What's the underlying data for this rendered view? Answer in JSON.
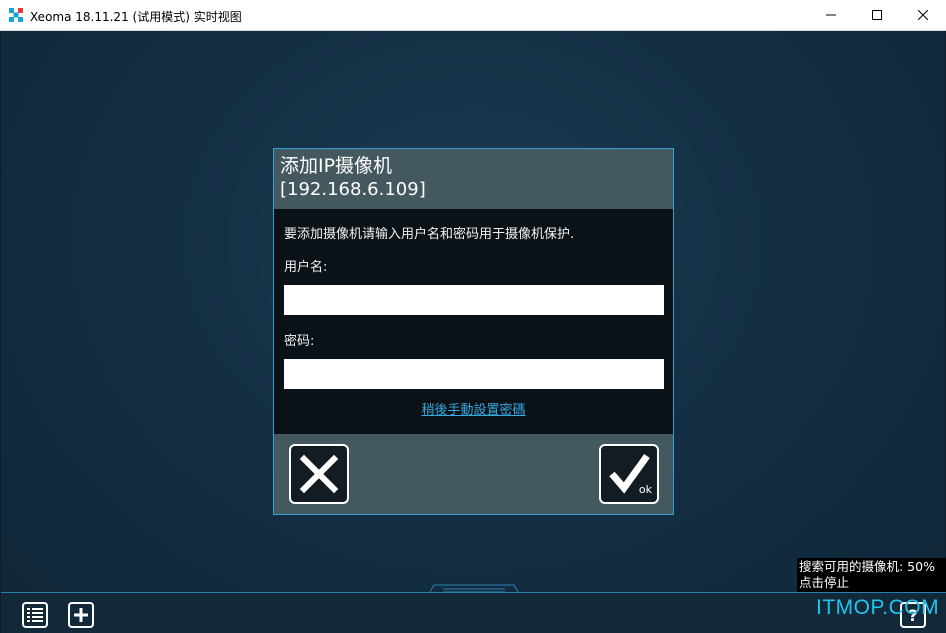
{
  "window": {
    "title": "Xeoma 18.11.21 (试用模式) 实时视图",
    "icons": {
      "app": "xeoma-logo-icon",
      "minimize": "minimize-icon",
      "maximize": "maximize-icon",
      "close": "close-icon"
    }
  },
  "dialog": {
    "title": "添加IP摄像机",
    "subtitle": "[192.168.6.109]",
    "message": "要添加摄像机请输入用户名和密码用于摄像机保护.",
    "username_label": "用户名:",
    "username_value": "",
    "password_label": "密码:",
    "password_value": "",
    "later_link": "稍後手動設置密碼",
    "ok_label": "ok",
    "icons": {
      "cancel": "cross-icon",
      "ok": "checkmark-icon"
    }
  },
  "status": {
    "search_line1": "搜索可用的摄像机: 50%",
    "search_line2": "点击停止",
    "search_progress_percent": 50
  },
  "toolbar": {
    "icons": {
      "list": "list-icon",
      "add": "plus-icon",
      "help": "help-icon"
    },
    "help_label": "?"
  },
  "watermark": {
    "text": "ITMOP.COM"
  },
  "colors": {
    "background": "#142f44",
    "dialog_header": "#44595f",
    "accent": "#2fa3d6",
    "link": "#37a9e0"
  }
}
